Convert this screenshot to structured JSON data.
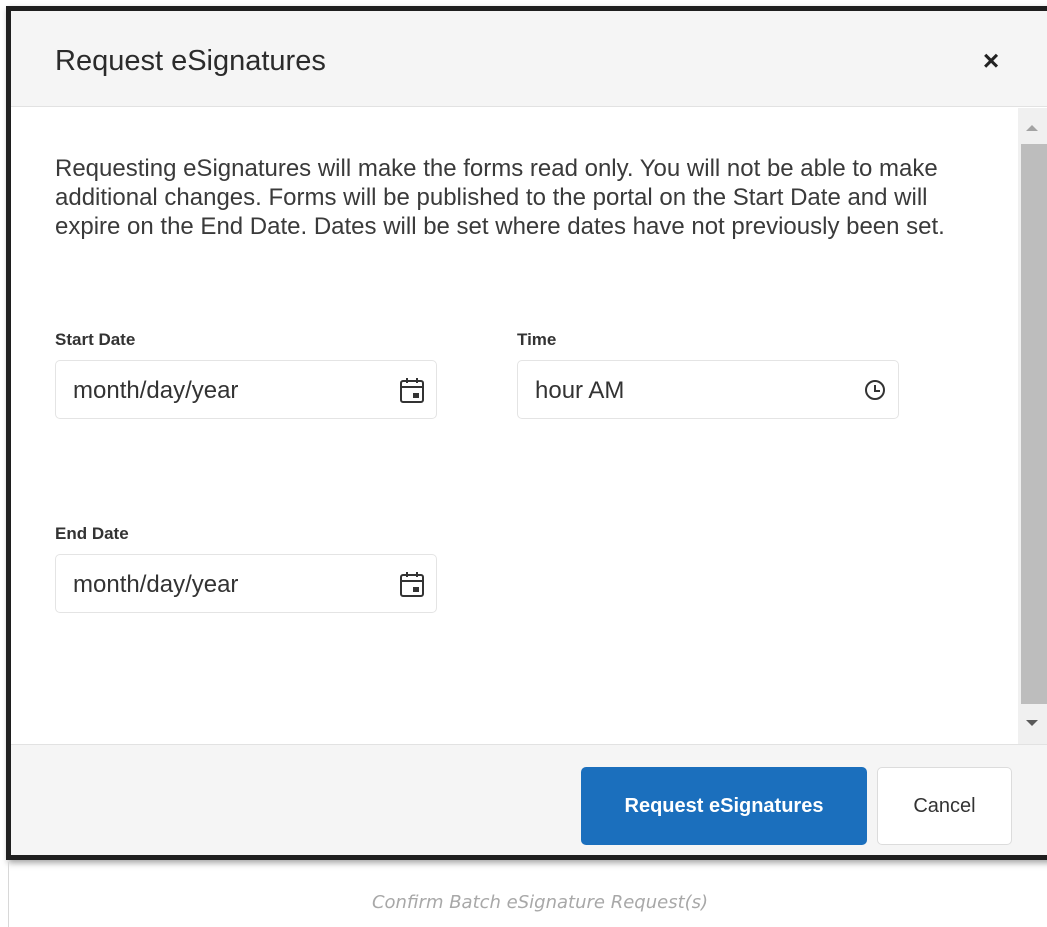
{
  "dialog": {
    "title": "Request eSignatures",
    "close_label": "×",
    "description": "Requesting eSignatures will make the forms read only. You will not be able to make additional changes. Forms will be published to the portal on the Start Date and will expire on the End Date. Dates will be set where dates have not previously been set.",
    "start_date": {
      "label": "Start Date",
      "value": "month/day/year",
      "icon": "calendar-icon"
    },
    "time": {
      "label": "Time",
      "value": "hour AM",
      "icon": "clock-icon"
    },
    "end_date": {
      "label": "End Date",
      "value": "month/day/year",
      "icon": "calendar-icon"
    },
    "footer": {
      "primary_label": "Request eSignatures",
      "cancel_label": "Cancel",
      "primary_color": "#1b6fbd"
    }
  },
  "caption": "Confirm Batch eSignature Request(s)"
}
